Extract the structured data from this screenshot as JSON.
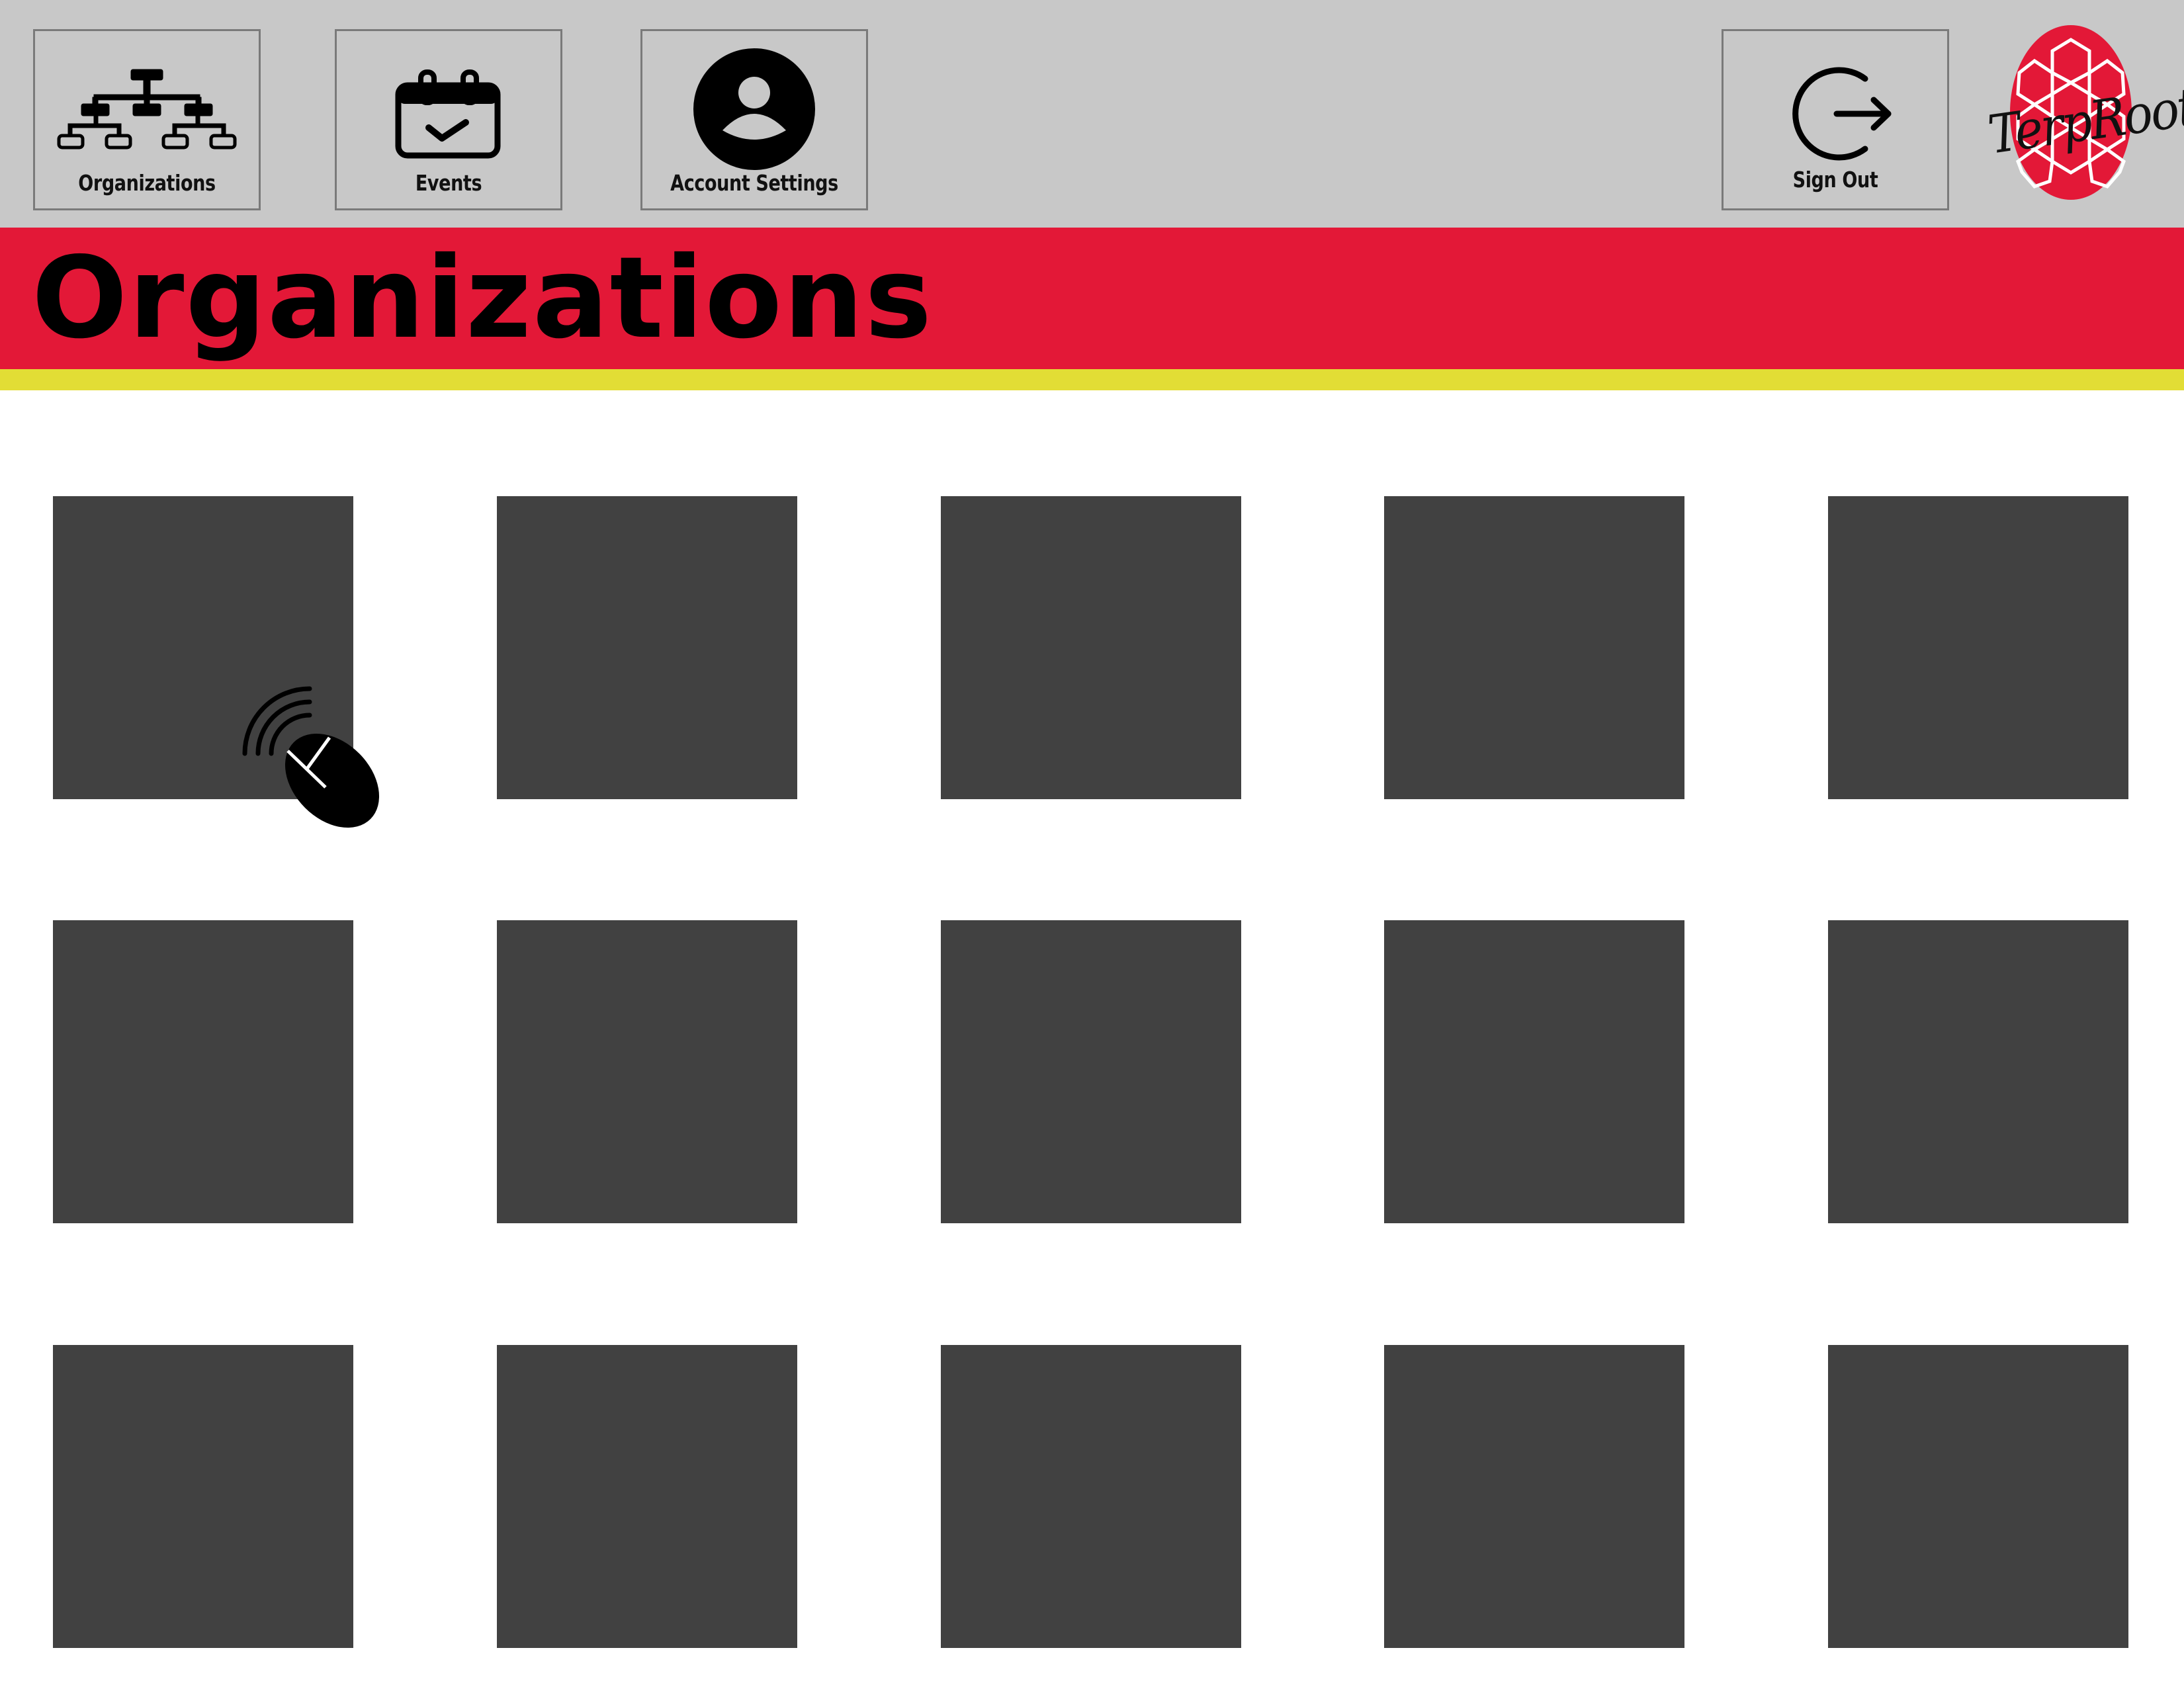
{
  "nav": {
    "organizations": {
      "label": "Organizations",
      "icon": "org-chart-icon"
    },
    "events": {
      "label": "Events",
      "icon": "calendar-check-icon"
    },
    "account_settings": {
      "label": "Account Settings",
      "icon": "user-circle-icon"
    },
    "sign_out": {
      "label": "Sign Out",
      "icon": "sign-out-icon"
    }
  },
  "logo": {
    "text": "TerpRoots",
    "icon": "turtle-shell-icon"
  },
  "page": {
    "title": "Organizations"
  },
  "organizations": {
    "tile_count": 15,
    "rows": 3,
    "columns": 5
  },
  "cursor": {
    "icon": "mouse-click-icon"
  },
  "colors": {
    "topbar": "#c8c8c8",
    "brand_red": "#e31837",
    "accent_yellow": "#e2dd35",
    "tile": "#414141"
  }
}
